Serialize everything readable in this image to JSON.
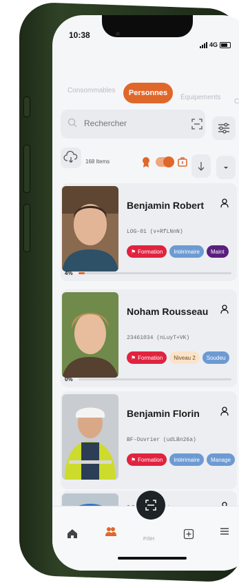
{
  "status": {
    "time": "10:38",
    "network": "4G"
  },
  "tabs": [
    {
      "label": "Consommables",
      "active": false
    },
    {
      "label": "Personnes",
      "active": true
    },
    {
      "label": "Équipements",
      "active": false
    },
    {
      "label": "C",
      "active": false
    }
  ],
  "search": {
    "placeholder": "Rechercher"
  },
  "toolbar": {
    "items_count": "168 Items"
  },
  "colors": {
    "accent": "#e0672a",
    "tag_red": "#e0233f",
    "tag_blue": "#6d9ad2",
    "tag_purple": "#5a1f7e"
  },
  "people": [
    {
      "name": "Benjamin Robert",
      "code": "LOG-01 (v+RfLNnN)",
      "tags": [
        "Formation",
        "Intérimaire",
        "Maint"
      ],
      "progress_label": "4%",
      "progress": 0.04
    },
    {
      "name": "Noham Rousseau",
      "code": "23461034 (nLuyT+VK)",
      "tags": [
        "Formation",
        "Niveau 2",
        "Soudeu"
      ],
      "progress_label": "0%",
      "progress": 0
    },
    {
      "name": "Benjamin Florin",
      "code": "BF-Ouvrier (udLBn26a)",
      "tags": [
        "Formation",
        "Intérimaire",
        "Manage"
      ]
    },
    {
      "name": "Mat    ubert"
    }
  ],
  "nav": {
    "items": [
      "home-icon",
      "people-icon",
      "scan-icon",
      "add-icon",
      "menu-icon"
    ],
    "fab_caption": "FISH"
  }
}
